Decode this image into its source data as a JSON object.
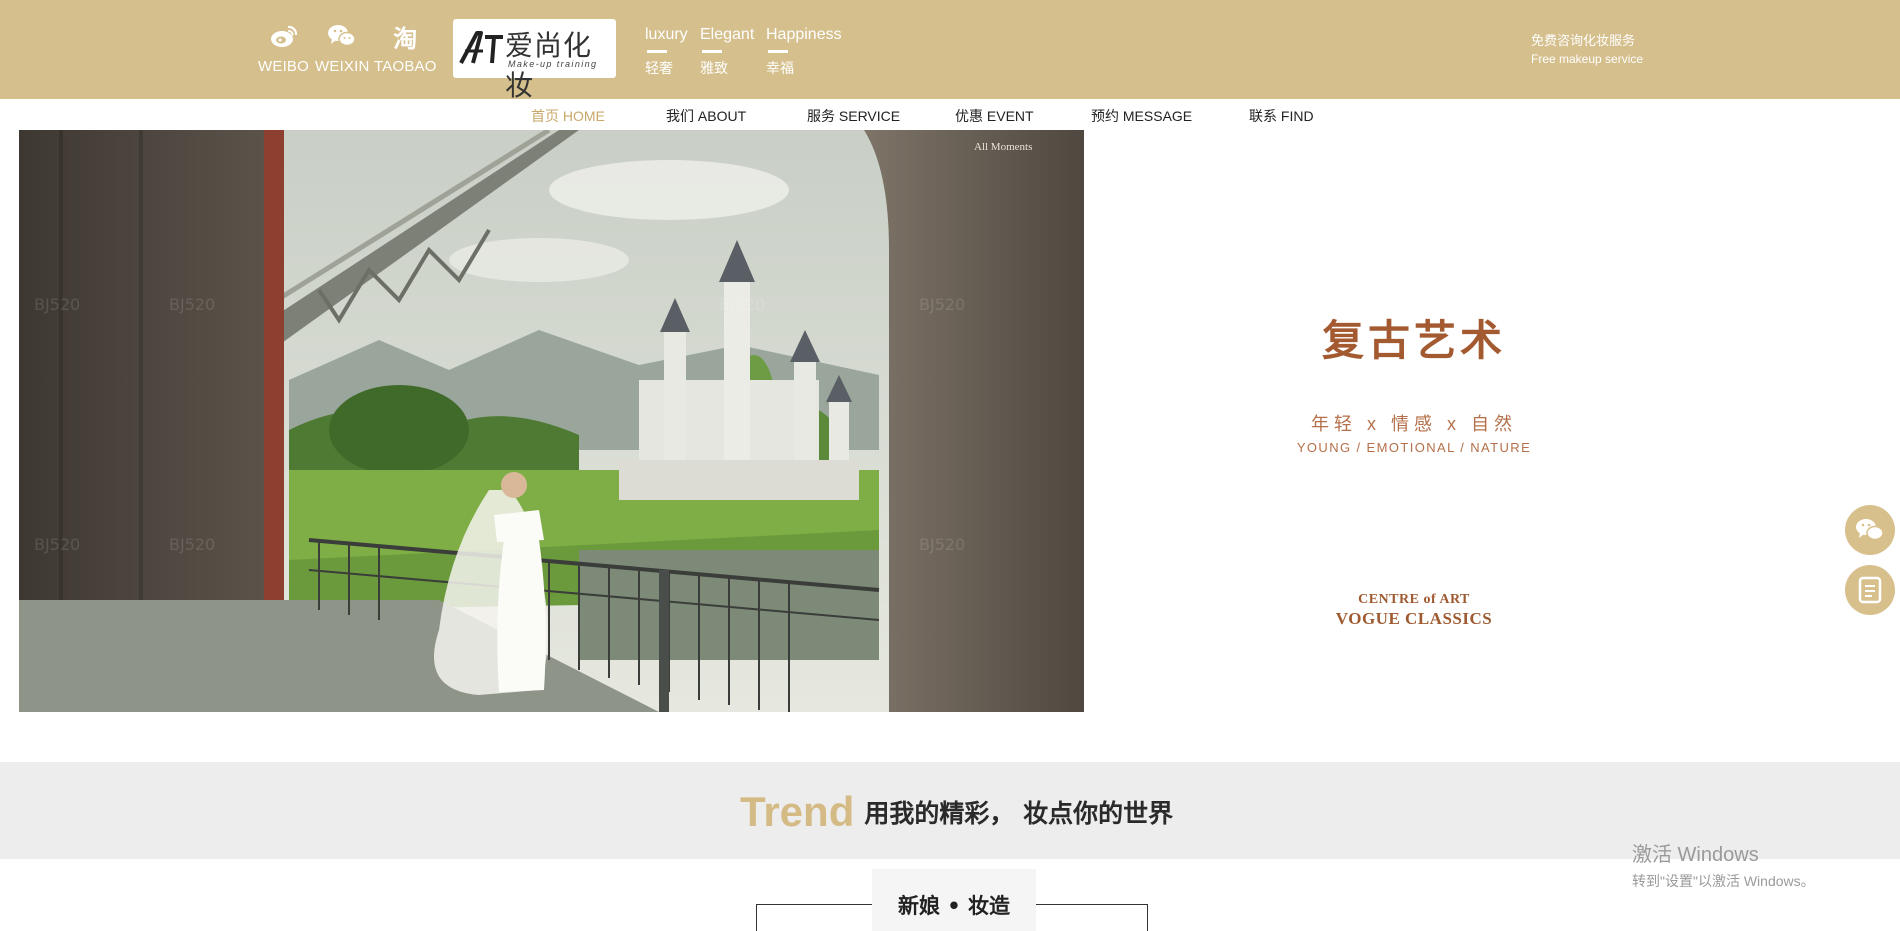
{
  "header": {
    "social": [
      {
        "label": "WEIBO",
        "icon": "weibo-icon"
      },
      {
        "label": "WEIXIN",
        "icon": "wechat-icon"
      },
      {
        "label": "TAOBAO",
        "icon": "taobao-icon",
        "glyph": "淘"
      }
    ],
    "logo": {
      "mark": "AI",
      "cn": "爱尚化妆",
      "en": "Make-up training"
    },
    "mottos": [
      {
        "en": "luxury",
        "cn": "轻奢"
      },
      {
        "en": "Elegant",
        "cn": "雅致"
      },
      {
        "en": "Happiness",
        "cn": "幸福"
      }
    ],
    "free_service": {
      "cn": "免费咨询化妆服务",
      "en": "Free makeup service"
    }
  },
  "nav": {
    "items": [
      {
        "label": "首页 HOME",
        "active": true
      },
      {
        "label": "我们 ABOUT",
        "active": false
      },
      {
        "label": "服务 SERVICE",
        "active": false
      },
      {
        "label": "优惠 EVENT",
        "active": false
      },
      {
        "label": "预约 MESSAGE",
        "active": false
      },
      {
        "label": "联系 FIND",
        "active": false
      }
    ]
  },
  "hero": {
    "photo_caption": "All Moments",
    "slides_total": 4,
    "slide_active": 4,
    "title": "复古艺术",
    "subtitle_cn": "年轻 x 情感 x 自然",
    "subtitle_en": "YOUNG / EMOTIONAL / NATURE",
    "centre": "CENTRE of ART",
    "vogue": "VOGUE CLASSICS"
  },
  "float": {
    "buttons": [
      {
        "icon": "wechat-icon"
      },
      {
        "icon": "message-icon"
      }
    ]
  },
  "trend": {
    "title_en": "Trend",
    "title_cn": "用我的精彩， 妆点你的世界",
    "tab_label": "新娘 • 妆造"
  },
  "watermark": {
    "line1": "激活 Windows",
    "line2": "转到\"设置\"以激活 Windows。"
  },
  "colors": {
    "header_bg": "#d5bf8c",
    "accent_gold": "#c9a86a",
    "hero_brown": "#a45a30",
    "band_bg": "#ededed"
  }
}
